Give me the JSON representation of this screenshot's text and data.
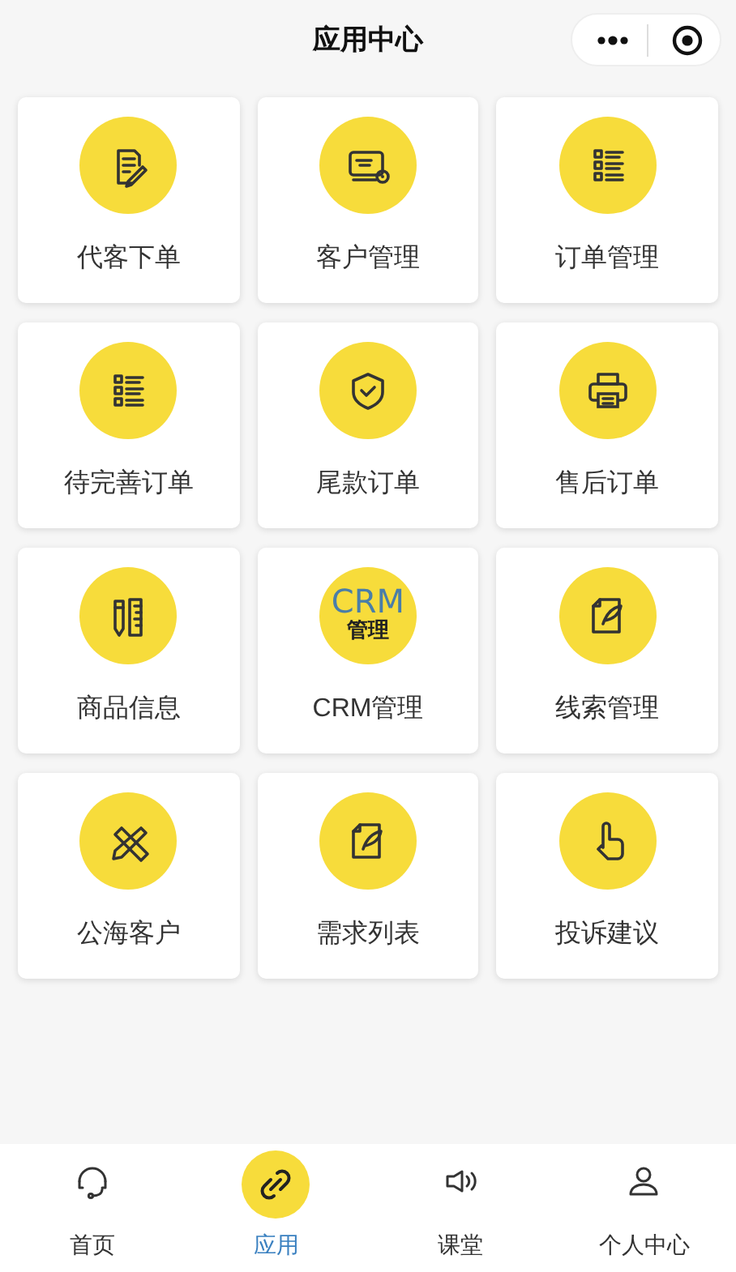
{
  "header": {
    "title": "应用中心"
  },
  "tiles": [
    {
      "kind": "icon",
      "label": "代客下单"
    },
    {
      "kind": "icon",
      "label": "客户管理"
    },
    {
      "kind": "icon",
      "label": "订单管理"
    },
    {
      "kind": "icon",
      "label": "待完善订单"
    },
    {
      "kind": "icon",
      "label": "尾款订单"
    },
    {
      "kind": "icon",
      "label": "售后订单"
    },
    {
      "kind": "icon",
      "label": "商品信息"
    },
    {
      "kind": "badge",
      "label": "CRM管理"
    },
    {
      "kind": "icon",
      "label": "线索管理"
    },
    {
      "kind": "icon",
      "label": "公海客户"
    },
    {
      "kind": "icon",
      "label": "需求列表"
    },
    {
      "kind": "icon",
      "label": "投诉建议"
    }
  ],
  "crm_badge": {
    "top": "CRM",
    "bottom": "管理"
  },
  "tab_bar": [
    {
      "label": "首页",
      "selected": false
    },
    {
      "label": "应用",
      "selected": true
    },
    {
      "label": "课堂",
      "selected": false
    },
    {
      "label": "个人中心",
      "selected": false
    }
  ]
}
